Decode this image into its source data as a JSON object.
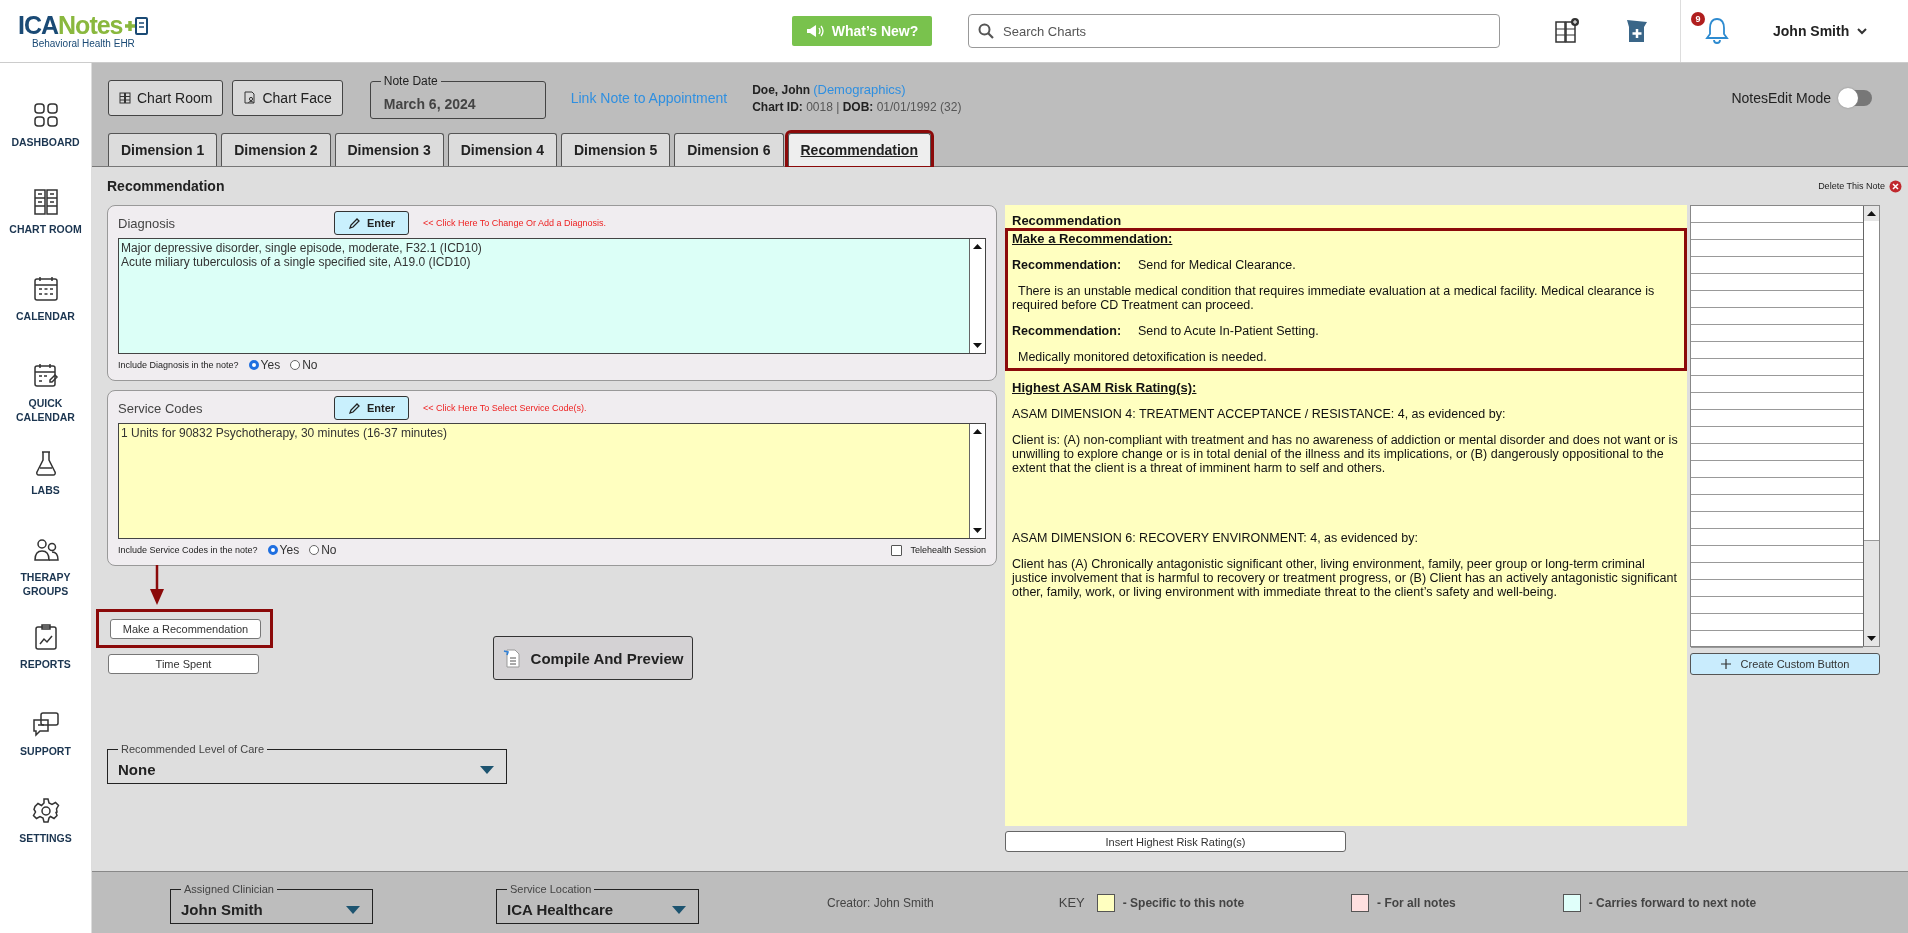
{
  "header": {
    "logo_a": "ICA",
    "logo_b": "Notes",
    "logo_tagline": "Behavioral Health EHR",
    "whats_new": "What’s New?",
    "search": {
      "placeholder": "Search Charts"
    },
    "notification_count": "9",
    "user_name": "John Smith"
  },
  "sidebar": {
    "items": [
      {
        "label": "DASHBOARD"
      },
      {
        "label": "CHART ROOM"
      },
      {
        "label": "CALENDAR"
      },
      {
        "label": "QUICK CALENDAR"
      },
      {
        "label": "LABS"
      },
      {
        "label": "THERAPY GROUPS"
      },
      {
        "label": "REPORTS"
      },
      {
        "label": "SUPPORT"
      },
      {
        "label": "SETTINGS"
      }
    ]
  },
  "toolbar": {
    "chart_room": "Chart Room",
    "chart_face": "Chart Face",
    "note_date": {
      "label": "Note Date",
      "value": "March 6, 2024"
    },
    "link": "Link Note to Appointment",
    "patient": {
      "name": "Doe, John",
      "demographics": "(Demographics)",
      "details": "**Chart ID:** 0018 | **DOB:** 01/01/1992 (32)"
    },
    "edit_mode": {
      "label": "NotesEdit Mode",
      "on": false
    }
  },
  "tabs": [
    {
      "label": "Dimension 1",
      "selected": false,
      "highlighted": false
    },
    {
      "label": "Dimension 2",
      "selected": false,
      "highlighted": false
    },
    {
      "label": "Dimension 3",
      "selected": false,
      "highlighted": false
    },
    {
      "label": "Dimension 4",
      "selected": false,
      "highlighted": false
    },
    {
      "label": "Dimension 5",
      "selected": false,
      "highlighted": false
    },
    {
      "label": "Dimension 6",
      "selected": false,
      "highlighted": false
    },
    {
      "label": "Recommendation",
      "selected": true,
      "highlighted": true
    }
  ],
  "section_title": "Recommendation",
  "delete_note": "Delete This Note",
  "panels": [
    {
      "title": "Diagnosis",
      "enter": "Enter",
      "hint": "<< Click Here To Change Or Add a Diagnosis.",
      "lines": [
        "Major depressive disorder, single episode, moderate, F32.1 (ICD10)",
        "Acute miliary tuberculosis of a single specified site, A19.0 (ICD10)"
      ],
      "include_label": "Include Diagnosis in the note?",
      "options": [
        {
          "label": "Yes",
          "selected": true
        },
        {
          "label": "No",
          "selected": false
        }
      ]
    },
    {
      "title": "Service Codes",
      "enter": "Enter",
      "hint": "<< Click Here To Select Service Code(s).",
      "lines": [
        "1 Units for 90832 Psychotherapy, 30 minutes (16-37 minutes)"
      ],
      "include_label": "Include Service Codes in the note?",
      "options": [
        {
          "label": "Yes",
          "selected": true
        },
        {
          "label": "No",
          "selected": false
        }
      ],
      "telehealth": {
        "label": "Telehealth Session",
        "checked": false
      }
    }
  ],
  "actions": {
    "make_recommendation": {
      "label": "Make a Recommendation",
      "highlighted": true,
      "arrow": true
    },
    "time_spent": "Time Spent",
    "compile": "Compile And Preview"
  },
  "level_of_care": {
    "label": "Recommended Level of Care",
    "value": "None"
  },
  "note": {
    "title": "Recommendation",
    "sections": [
      {
        "heading": "Make a Recommendation:",
        "highlighted": true,
        "blocks": [
          {
            "kind": "rec",
            "label": "Recommendation:",
            "value": "Send for Medical Clearance."
          },
          {
            "kind": "text",
            "text": "There is an unstable medical condition that requires immediate evaluation at a medical facility. Medical clearance is required before CD Treatment can proceed."
          },
          {
            "kind": "rec",
            "label": "Recommendation:",
            "value": "Send to Acute In-Patient Setting."
          },
          {
            "kind": "text",
            "text": "Medically monitored detoxification is needed."
          }
        ]
      },
      {
        "heading": "Highest ASAM Risk Rating(s):",
        "highlighted": false,
        "blocks": [
          {
            "kind": "plain",
            "text": "ASAM DIMENSION 4: TREATMENT ACCEPTANCE / RESISTANCE: 4, as evidenced by:"
          },
          {
            "kind": "plain",
            "text": "Client is: (A) non-compliant with treatment and has no awareness of addiction or mental disorder and does not want or is unwilling to explore change or is in total denial of the illness and its implications, or (B) dangerously oppositional to the extent that the client is a threat of imminent harm to self and others."
          },
          {
            "kind": "plain",
            "text": "ASAM DIMENSION 6: RECOVERY ENVIRONMENT: 4, as evidenced by:"
          },
          {
            "kind": "plain",
            "text": "Client has (A) Chronically antagonistic significant other, living environment, family, peer group or long-term criminal justice involvement that is harmful to recovery or treatment progress, or (B) Client has an actively antagonistic significant other, family, work, or living environment with immediate threat to the client’s safety and well-being."
          }
        ]
      }
    ]
  },
  "insert_button": "Insert Highest Risk Rating(s)",
  "create_custom_button": "Create Custom Button",
  "footer": {
    "clinician": {
      "label": "Assigned Clinician",
      "value": "John Smith"
    },
    "location": {
      "label": "Service Location",
      "value": "ICA Healthcare"
    },
    "creator": "Creator: John Smith",
    "key_label": "KEY",
    "legend": [
      {
        "label": "- Specific to this note",
        "color": "#ffffc0"
      },
      {
        "label": "- For all notes",
        "color": "#ffe0e0"
      },
      {
        "label": "- Carries forward to next note",
        "color": "#e0fffa"
      }
    ]
  }
}
